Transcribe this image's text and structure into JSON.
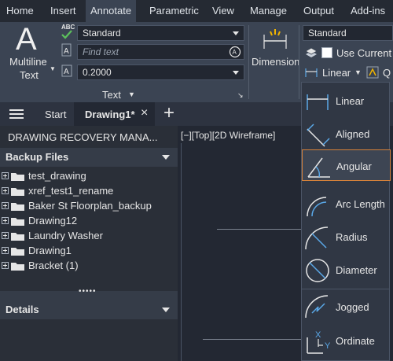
{
  "menu": {
    "tabs": [
      "Home",
      "Insert",
      "Annotate",
      "Parametric",
      "View",
      "Manage",
      "Output",
      "Add-ins"
    ],
    "active": "Annotate"
  },
  "ribbon": {
    "multiline_text_label_1": "Multiline",
    "multiline_text_label_2": "Text",
    "abc_label": "ABC",
    "text_style_value": "Standard",
    "find_text_placeholder": "Find text",
    "text_height_value": "0.2000",
    "text_panel_label": "Text",
    "dimension_label": "Dimension",
    "dim_style_value": "Standard",
    "use_current_label": "Use Current",
    "linear_label": "Linear",
    "partial_q": "Q"
  },
  "tabs": {
    "start_label": "Start",
    "drawing_label": "Drawing1*"
  },
  "recovery": {
    "title": "DRAWING RECOVERY MANA...",
    "backup_header": "Backup Files",
    "items": [
      "test_drawing",
      "xref_test1_rename",
      "Baker St Floorplan_backup",
      "Drawing12",
      "Laundry Washer",
      "Drawing1",
      "Bracket (1)"
    ],
    "details_header": "Details"
  },
  "viewport": {
    "label": "[−][Top][2D Wireframe]"
  },
  "dim_dropdown": {
    "items": [
      "Linear",
      "Aligned",
      "Angular",
      "Arc Length",
      "Radius",
      "Diameter",
      "Jogged",
      "Ordinate"
    ],
    "selected": "Angular"
  },
  "colors": {
    "accent_blue": "#5aa8e8",
    "selection_orange": "#d4813a",
    "ribbon_bg": "#3b4453"
  },
  "icons": [
    "hamburger-menu-icon",
    "close-icon",
    "plus-icon",
    "folder-icon",
    "dimension-icon",
    "layers-icon",
    "text-A-icon",
    "spell-check-icon",
    "find-text-icon"
  ]
}
